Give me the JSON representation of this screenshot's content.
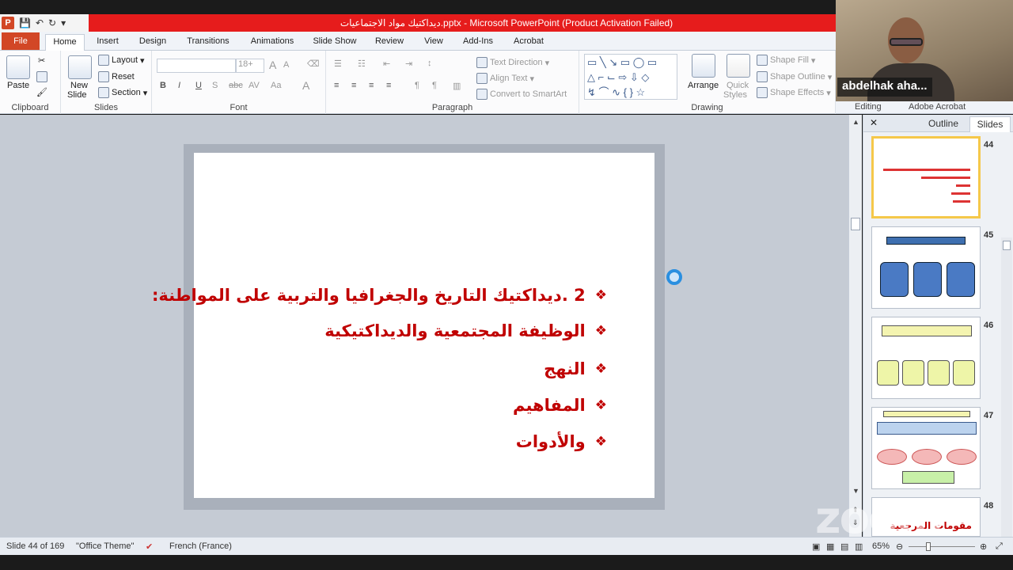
{
  "window": {
    "title": "ديداكتيك مواد الاجتماعيات.pptx  -  Microsoft PowerPoint (Product Activation Failed)"
  },
  "ribbon_tabs": [
    "File",
    "Home",
    "Insert",
    "Design",
    "Transitions",
    "Animations",
    "Slide Show",
    "Review",
    "View",
    "Add-Ins",
    "Acrobat"
  ],
  "active_tab": "Home",
  "ribbon": {
    "clipboard": {
      "paste": "Paste",
      "label": "Clipboard"
    },
    "slides": {
      "new_slide": "New",
      "new_slide2": "Slide",
      "layout": "Layout",
      "reset": "Reset",
      "section": "Section",
      "label": "Slides"
    },
    "font": {
      "size": "18+",
      "label": "Font"
    },
    "paragraph": {
      "text_direction": "Text Direction",
      "align_text": "Align Text",
      "convert": "Convert to SmartArt",
      "label": "Paragraph"
    },
    "drawing": {
      "arrange": "Arrange",
      "quick_styles": "Quick",
      "quick_styles2": "Styles",
      "shape_fill": "Shape Fill",
      "shape_outline": "Shape Outline",
      "shape_effects": "Shape Effects",
      "label": "Drawing"
    },
    "extra": {
      "editing": "Editing",
      "acrobat": "Adobe Acrobat"
    }
  },
  "webcam": {
    "name": "abdelhak aha..."
  },
  "panel": {
    "outline_tab": "Outline",
    "slides_tab": "Slides",
    "close": "✕"
  },
  "slide": {
    "bullets": [
      "2 .ديداكتيك التاريخ والجغرافيا والتربية على المواطنة:",
      "الوظيفة المجتمعية والديداكتيكية",
      "النهج",
      "المفاهيم",
      "والأدوات"
    ],
    "bullet_symbol": "❖"
  },
  "thumbnails": [
    {
      "num": "44"
    },
    {
      "num": "45"
    },
    {
      "num": "46"
    },
    {
      "num": "47"
    },
    {
      "num": "48",
      "text": "مقومات المرجعية"
    }
  ],
  "status": {
    "slide": "Slide 44 of 169",
    "theme": "\"Office Theme\"",
    "language": "French (France)",
    "zoom": "65%"
  },
  "watermark": "zoom"
}
